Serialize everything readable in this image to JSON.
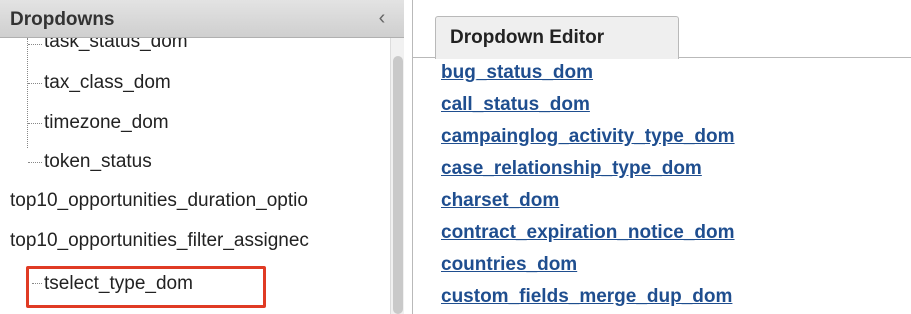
{
  "left_panel": {
    "title": "Dropdowns",
    "collapse_icon": "chevron-left-icon",
    "items": [
      {
        "label": "task_status_dom"
      },
      {
        "label": "tax_class_dom"
      },
      {
        "label": "timezone_dom"
      },
      {
        "label": "token_status"
      },
      {
        "label": "top10_opportunities_duration_optio"
      },
      {
        "label": "top10_opportunities_filter_assignec"
      },
      {
        "label": "tselect_type_dom"
      }
    ]
  },
  "right_panel": {
    "tab_label": "Dropdown Editor",
    "links": [
      "bug_status_dom",
      "call_status_dom",
      "campainglog_activity_type_dom",
      "case_relationship_type_dom",
      "charset_dom",
      "contract_expiration_notice_dom",
      "countries_dom",
      "custom_fields_merge_dup_dom"
    ]
  },
  "colors": {
    "highlight": "#e03b24",
    "link": "#1f4e8f"
  }
}
